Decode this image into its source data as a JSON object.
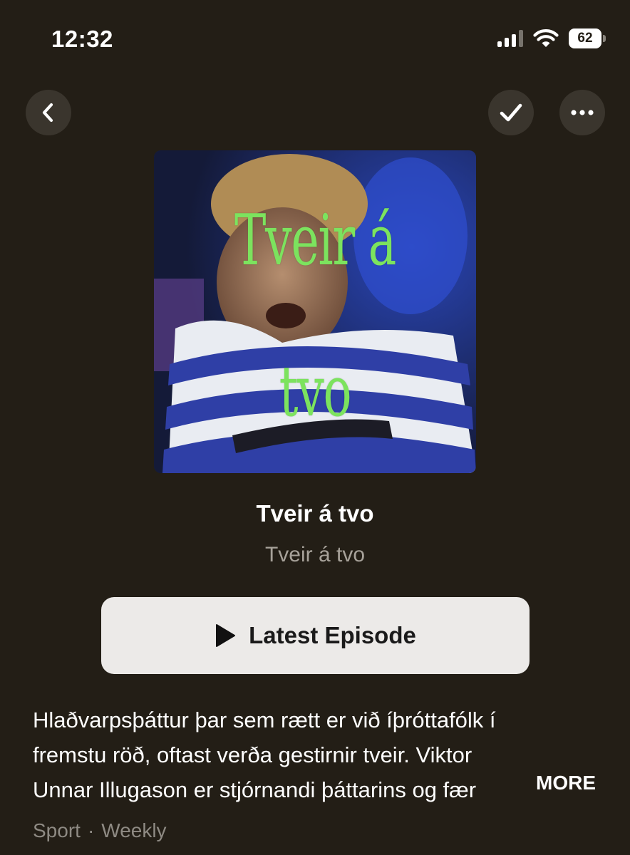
{
  "status_bar": {
    "time": "12:32",
    "battery": "62"
  },
  "podcast": {
    "artwork_text_line1": "Tveir á",
    "artwork_text_line2": "tvo",
    "title": "Tveir á tvo",
    "author": "Tveir á tvo"
  },
  "actions": {
    "play_label": "Latest Episode"
  },
  "description": {
    "line1": "Hlaðvarpsþáttur þar sem rætt er við íþróttafólk í",
    "line2": "fremstu röð, oftast verða gestirnir tveir.  Viktor",
    "line3": "Unnar Illugason er stjórnandi þáttarins og fær",
    "more_label": "MORE"
  },
  "meta": {
    "category": "Sport",
    "separator": "·",
    "frequency": "Weekly"
  },
  "colors": {
    "background": "#231e16",
    "button_bg": "#eceae8",
    "artwork_text": "#7ce35e"
  },
  "icons": {
    "back": "chevron-left-icon",
    "subscribed": "checkmark-icon",
    "more": "ellipsis-icon",
    "play": "play-icon"
  }
}
